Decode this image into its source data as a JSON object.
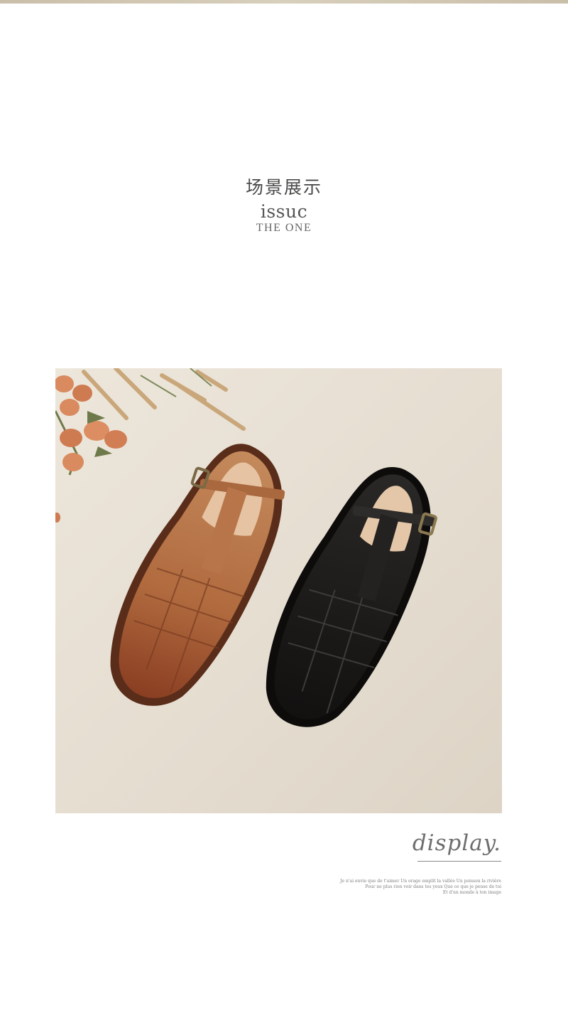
{
  "header": {
    "section_title": "场景展示",
    "brand_name": "issuc",
    "brand_subtitle": "THE ONE"
  },
  "scene": {
    "objects": [
      "tan-woven-sandal",
      "black-woven-sandal",
      "orange-roses",
      "dried-wheat"
    ],
    "colors": {
      "background": "#e6ded1",
      "tan_leather": "#b8744a",
      "black_leather": "#1c1b1a",
      "roses": "#d8825a"
    }
  },
  "footer": {
    "display_word": "display.",
    "caption_lines": [
      "Je n'ai envie que de t'aimer Un orage emplit la vallée Un poisson la rivière",
      "Pour ne plus rien voir dans tes yeux Que ce que je pense de toi",
      "Et d'un monde à ton image"
    ]
  }
}
